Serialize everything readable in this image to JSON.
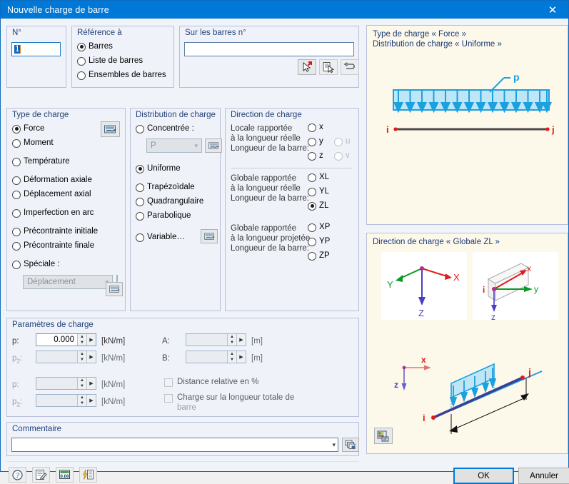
{
  "window": {
    "title": "Nouvelle charge de barre",
    "close_icon": "close-icon"
  },
  "no_group": {
    "caption": "N°",
    "value": "1"
  },
  "reference_group": {
    "caption": "Référence à",
    "options": [
      {
        "label": "Barres",
        "selected": true
      },
      {
        "label": "Liste de barres",
        "selected": false
      },
      {
        "label": "Ensembles de barres",
        "selected": false
      }
    ]
  },
  "members_group": {
    "caption": "Sur les barres n°",
    "value": "",
    "buttons": [
      {
        "icon": "pick-member-icon"
      },
      {
        "icon": "pick-from-list-icon"
      },
      {
        "icon": "undo-selection-icon"
      }
    ]
  },
  "load_type_group": {
    "caption": "Type de charge",
    "settings_icon": "settings-icon",
    "options": [
      {
        "label": "Force",
        "selected": true
      },
      {
        "label": "Moment",
        "selected": false
      },
      {
        "label": "Température",
        "selected": false
      },
      {
        "label": "Déformation axiale",
        "selected": false
      },
      {
        "label": "Déplacement axial",
        "selected": false
      },
      {
        "label": "Imperfection en arc",
        "selected": false
      },
      {
        "label": "Précontrainte initiale",
        "selected": false
      },
      {
        "label": "Précontrainte finale",
        "selected": false
      },
      {
        "label": "Spéciale :",
        "selected": false
      }
    ],
    "special_combo_value": "Déplacement",
    "special_combo_icon": "settings-icon"
  },
  "distribution_group": {
    "caption": "Distribution de charge",
    "options": [
      {
        "label": "Concentrée :",
        "selected": false
      },
      {
        "label": "Uniforme",
        "selected": true
      },
      {
        "label": "Trapézoïdale",
        "selected": false
      },
      {
        "label": "Quadrangulaire",
        "selected": false
      },
      {
        "label": "Parabolique",
        "selected": false
      },
      {
        "label": "Variable…",
        "selected": false
      }
    ],
    "concentrated_combo_value": "P",
    "concentrated_combo_icon": "settings-icon",
    "variable_icon": "settings-icon"
  },
  "direction_group": {
    "caption": "Direction de charge",
    "blocks": [
      {
        "lines": [
          "Locale rapportée",
          "à la longueur réelle",
          "Longueur de la barre:"
        ],
        "radios": [
          {
            "label": "x",
            "selected": false,
            "disabled": false
          },
          {
            "label": "y",
            "selected": false,
            "disabled": false
          },
          {
            "label": "z",
            "selected": false,
            "disabled": false
          },
          {
            "label": "u",
            "selected": false,
            "disabled": true
          },
          {
            "label": "v",
            "selected": false,
            "disabled": true
          }
        ]
      },
      {
        "lines": [
          "Globale rapportée",
          "à la longueur réelle",
          "Longueur de la barre:"
        ],
        "radios": [
          {
            "label": "XL",
            "selected": false,
            "disabled": false
          },
          {
            "label": "YL",
            "selected": false,
            "disabled": false
          },
          {
            "label": "ZL",
            "selected": true,
            "disabled": false
          }
        ]
      },
      {
        "lines": [
          "Globale rapportée",
          "à la longueur projetée",
          "Longueur de la barre:"
        ],
        "radios": [
          {
            "label": "XP",
            "selected": false,
            "disabled": false
          },
          {
            "label": "YP",
            "selected": false,
            "disabled": false
          },
          {
            "label": "ZP",
            "selected": false,
            "disabled": false
          }
        ]
      }
    ]
  },
  "parameters_group": {
    "caption": "Paramètres de charge",
    "fields": [
      {
        "label": "p:",
        "sub": "",
        "value": "0.000",
        "unit": "[kN/m]",
        "disabled": false
      },
      {
        "label": "p",
        "sub": "2",
        "value": "",
        "unit": "[kN/m]",
        "disabled": true
      },
      {
        "label": "p:",
        "sub": "",
        "value": "",
        "unit": "[kN/m]",
        "disabled": true
      },
      {
        "label": "p",
        "sub": "2",
        "value": "",
        "unit": "[kN/m]",
        "disabled": true
      }
    ],
    "distance_fields": [
      {
        "label": "A:",
        "value": "",
        "unit": "[m]",
        "disabled": true
      },
      {
        "label": "B:",
        "value": "",
        "unit": "[m]",
        "disabled": true
      }
    ],
    "checkboxes": [
      {
        "label": "Distance relative en %",
        "checked": false,
        "label2": ""
      },
      {
        "label": "Charge sur la longueur totale de",
        "checked": false,
        "label2": "barre"
      }
    ]
  },
  "comment_group": {
    "caption": "Commentaire",
    "value": "",
    "dropdown_icon": "chevron-down-icon",
    "button_icon": "comment-library-icon"
  },
  "preview_top": {
    "line1": "Type de charge « Force »",
    "line2": "Distribution de charge « Uniforme »",
    "load_label": "p",
    "node_start": "i",
    "node_end": "j",
    "arrow_count": 14,
    "load_color": "#1ba0e0",
    "fill_color": "#bfe6f7",
    "node_color": "#e01b1b"
  },
  "preview_bottom": {
    "title": "Direction de charge « Globale ZL »",
    "global_axes": {
      "x": "X",
      "y": "Y",
      "z": "Z"
    },
    "local_axes": {
      "x": "x",
      "y": "y",
      "z": "z",
      "node": "i"
    },
    "member_axes": {
      "x": "x",
      "z": "z"
    },
    "node_start": "i",
    "node_end": "j",
    "screenshot_icon": "screenshot-icon",
    "axis_x_color": "#e01b1b",
    "axis_y_color": "#0a9a25",
    "axis_z_color": "#4a3ec4"
  },
  "toolbar": {
    "buttons": [
      {
        "icon": "help-icon"
      },
      {
        "icon": "edit-icon"
      },
      {
        "icon": "units-icon"
      },
      {
        "icon": "load-wizard-icon"
      }
    ]
  },
  "footer": {
    "ok_label": "OK",
    "cancel_label": "Annuler"
  }
}
